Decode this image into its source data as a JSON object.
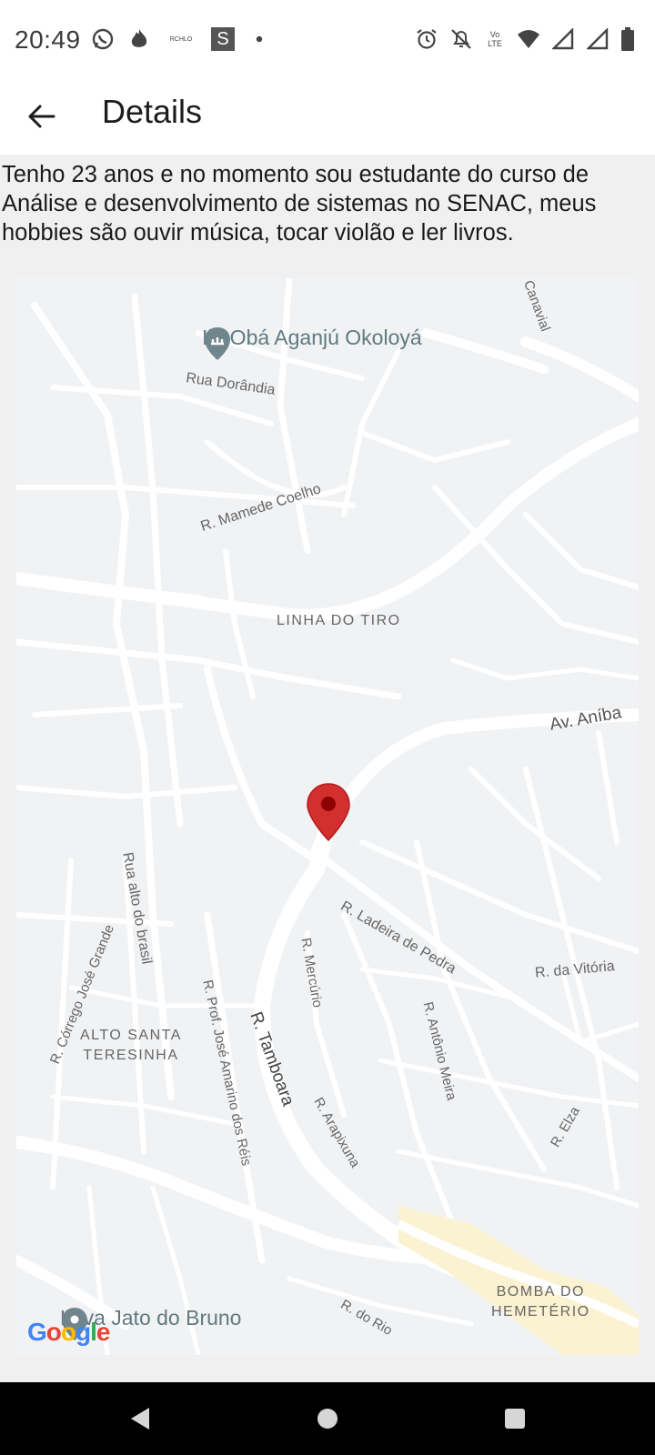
{
  "status_bar": {
    "time": "20:49",
    "left_icons": [
      "whatsapp-icon",
      "flame-icon",
      "richlo-icon",
      "s-app-icon",
      "dot-icon"
    ],
    "richlo_text": "RCHLO",
    "s_text": "S",
    "right_icons": [
      "alarm-icon",
      "mute-icon",
      "volte-icon",
      "wifi-icon",
      "signal-icon",
      "signal-icon",
      "battery-icon"
    ],
    "volte_text": "Vo LTE"
  },
  "app_bar": {
    "title": "Details"
  },
  "bio": "Tenho 23 anos e no momento sou estudante do curso de Análise e desenvolvimento de sistemas no SENAC, meus hobbies são ouvir música, tocar violão e ler livros.",
  "map": {
    "labels": {
      "poi_top": "Ilê Obá Aganjú Okoloyá",
      "rua_dorandia": "Rua Dorândia",
      "mamede": "R. Mamede Coelho",
      "linha": "LINHA DO TIRO",
      "aniba": "Av. Aníba",
      "ladeira": "R. Ladeira de Pedra",
      "vitoria": "R. da Vitória",
      "alto_brasil": "Rua alto do brasil",
      "corrego": "R. Córrego José Grande",
      "alto_santa_1": "ALTO SANTA",
      "alto_santa_2": "TERESINHA",
      "prof": "R. Prof. José Amarino dos Réis",
      "tamboara": "R. Tamboara",
      "mercurio": "R. Mercúrio",
      "antonio": "R. Antônio Meira",
      "arapixuna": "R. Arapixuna",
      "elza": "R. Elza",
      "canavial": "Canavial",
      "bomba_1": "BOMBA DO",
      "bomba_2": "HEMETÉRIO",
      "rio": "R. do Rio",
      "poi_bottom": "Lava Jato do Bruno"
    },
    "marker_color": "#d32f2f",
    "google_logo": "Google"
  },
  "nav_bar": {
    "buttons": [
      "back-triangle",
      "home-circle",
      "recents-square"
    ]
  }
}
